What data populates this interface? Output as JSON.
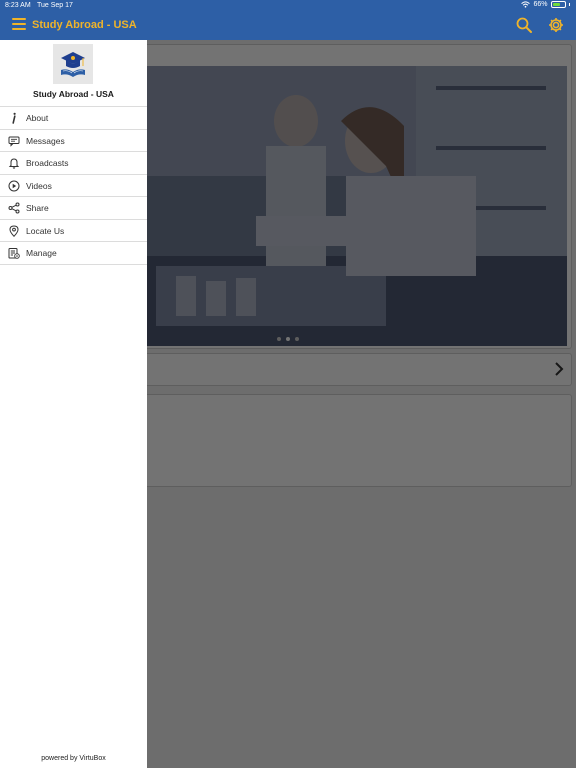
{
  "status": {
    "time": "8:23 AM",
    "date": "Tue Sep 17",
    "battery": "66%",
    "battery_level": 0.66
  },
  "appbar": {
    "title": "Study Abroad - USA",
    "accent": "#f0b429",
    "bar_color": "#2d5fa6"
  },
  "carousel": {
    "page_count": 3,
    "active_index": 1
  },
  "drawer": {
    "title": "Study Abroad - USA",
    "items": [
      {
        "label": "About",
        "icon": "info-icon"
      },
      {
        "label": "Messages",
        "icon": "messages-icon"
      },
      {
        "label": "Broadcasts",
        "icon": "bell-icon"
      },
      {
        "label": "Videos",
        "icon": "play-icon"
      },
      {
        "label": "Share",
        "icon": "share-icon"
      },
      {
        "label": "Locate Us",
        "icon": "location-pin-icon"
      },
      {
        "label": "Manage",
        "icon": "manage-icon"
      }
    ],
    "footer": "powered by VirtuBox"
  }
}
